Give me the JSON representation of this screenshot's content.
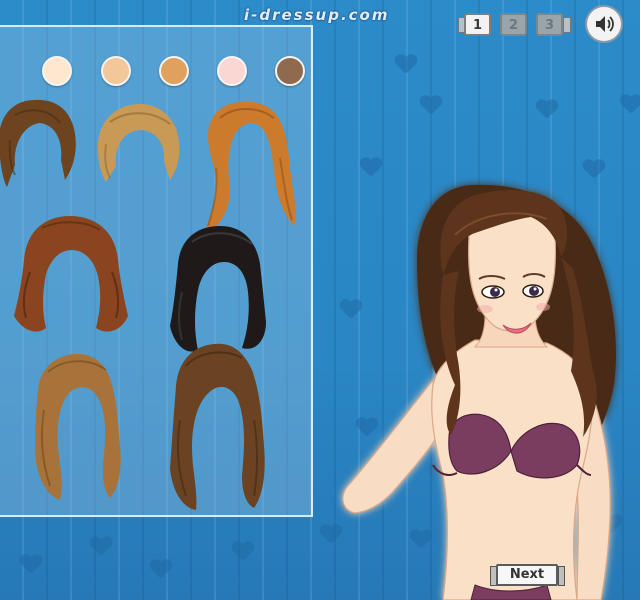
{
  "site": {
    "watermark": "i-dressup.com"
  },
  "skin_tones": [
    {
      "name": "light-cream",
      "color": "#fde8cf"
    },
    {
      "name": "peach",
      "color": "#f3c79a"
    },
    {
      "name": "tan",
      "color": "#e0a15e"
    },
    {
      "name": "pink",
      "color": "#fbd6d3"
    },
    {
      "name": "brown",
      "color": "#8f6a4e"
    }
  ],
  "hairstyles": [
    {
      "name": "short-brown-bob",
      "color": "#6e4420"
    },
    {
      "name": "short-blonde-bob",
      "color": "#c89a55"
    },
    {
      "name": "long-ginger-ponytail",
      "color": "#cc7a2c"
    },
    {
      "name": "curly-auburn-medium",
      "color": "#8a4520"
    },
    {
      "name": "long-black-wavy",
      "color": "#1f1a19"
    },
    {
      "name": "long-caramel-waves",
      "color": "#a8733a"
    },
    {
      "name": "long-brown-curls",
      "color": "#6b4322"
    }
  ],
  "page_nav": {
    "pages": [
      {
        "label": "1",
        "active": true
      },
      {
        "label": "2",
        "active": false
      },
      {
        "label": "3",
        "active": false
      }
    ]
  },
  "sound": {
    "icon": "speaker-icon"
  },
  "next_button": {
    "label": "Next"
  },
  "colors": {
    "background": "#2a86c4",
    "panel_border": "#d6ecfa",
    "bikini": "#7a3d5e"
  }
}
